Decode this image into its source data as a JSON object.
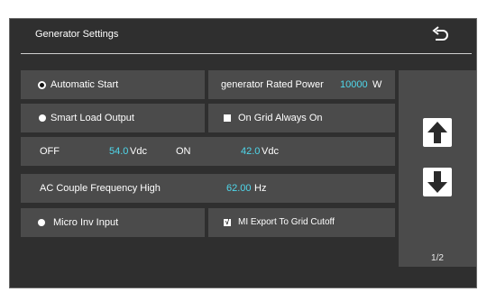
{
  "header": {
    "title": "Generator Settings",
    "back_icon": "back-arrow-icon"
  },
  "rows": {
    "automatic_start": {
      "label": "Automatic Start"
    },
    "rated_power": {
      "label": "generator Rated Power",
      "value": "10000",
      "unit": "W"
    },
    "smart_load": {
      "label": "Smart Load Output"
    },
    "on_grid": {
      "label": "On Grid Always On"
    },
    "off_label": "OFF",
    "off_value": "54.0",
    "off_unit": "Vdc",
    "on_label": "ON",
    "on_value": "42.0",
    "on_unit": "Vdc",
    "ac_couple": {
      "label": "AC Couple Frequency High",
      "value": "62.00",
      "unit": "Hz"
    },
    "micro_inv": {
      "label": "Micro Inv Input"
    },
    "mi_export": {
      "label": "MI Export To Grid Cutoff",
      "check_mark": "√"
    }
  },
  "nav": {
    "up_icon": "arrow-up-icon",
    "down_icon": "arrow-down-icon",
    "page": "1/2"
  },
  "colors": {
    "accent": "#4fd8ec",
    "panel": "#2f2f2f",
    "row": "#4b4b4b"
  }
}
